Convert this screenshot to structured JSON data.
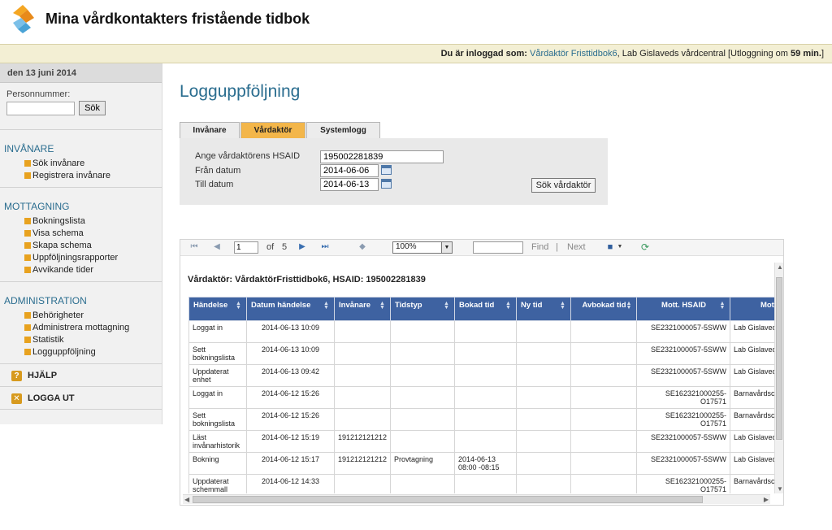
{
  "app": {
    "title": "Mina vårdkontakters fristående tidbok"
  },
  "login": {
    "prefix": "Du är inloggad som:",
    "user": "Vårdaktör Fristtidbok6",
    "unit": ", Lab Gislaveds vårdcentral [Utloggning om",
    "minutes": "59 min.",
    "suffix": "]"
  },
  "sidebar": {
    "date": "den 13 juni 2014",
    "pnr_label": "Personnummer:",
    "pnr_value": "",
    "search_label": "Sök",
    "sections": [
      {
        "title": "INVÅNARE",
        "items": [
          "Sök invånare",
          "Registrera invånare"
        ]
      },
      {
        "title": "MOTTAGNING",
        "items": [
          "Bokningslista",
          "Visa schema",
          "Skapa schema",
          "Uppföljningsrapporter",
          "Avvikande tider"
        ]
      },
      {
        "title": "ADMINISTRATION",
        "items": [
          "Behörigheter",
          "Administrera mottagning",
          "Statistik",
          "Logguppföljning"
        ]
      }
    ],
    "help_label": "HJÄLP",
    "logout_label": "LOGGA UT"
  },
  "main": {
    "title": "Logguppföljning",
    "tabs": [
      "Invånare",
      "Vårdaktör",
      "Systemlogg"
    ],
    "active_tab": "Vårdaktör",
    "filter": {
      "hsaid_label": "Ange vårdaktörens HSAID",
      "hsaid_value": "195002281839",
      "from_label": "Från datum",
      "from_value": "2014-06-06",
      "to_label": "Till datum",
      "to_value": "2014-06-13",
      "search_button": "Sök vårdaktör"
    }
  },
  "report": {
    "toolbar": {
      "page": "1",
      "of_label": "of",
      "total_pages": "5",
      "zoom": "100%",
      "find_value": "",
      "find_label": "Find",
      "separator": "|",
      "next_label": "Next"
    },
    "heading": "Vårdaktör: VårdaktörFristtidbok6, HSAID: 195002281839",
    "columns": [
      "Händelse",
      "Datum händelse",
      "Invånare",
      "Tidstyp",
      "Bokad tid",
      "Ny tid",
      "Avbokad tid",
      "Mott. HSAID",
      "Mott"
    ],
    "rows": [
      [
        "Loggat in",
        "2014-06-13 10:09",
        "",
        "",
        "",
        "",
        "",
        "SE2321000057-5SWW",
        "Lab Gislaved"
      ],
      [
        "Sett bokningslista",
        "2014-06-13 10:09",
        "",
        "",
        "",
        "",
        "",
        "SE2321000057-5SWW",
        "Lab Gislaved"
      ],
      [
        "Uppdaterat enhet",
        "2014-06-13 09:42",
        "",
        "",
        "",
        "",
        "",
        "SE2321000057-5SWW",
        "Lab Gislaved"
      ],
      [
        "Loggat in",
        "2014-06-12 15:26",
        "",
        "",
        "",
        "",
        "",
        "SE162321000255-O17571",
        "Barnavårdsc"
      ],
      [
        "Sett bokningslista",
        "2014-06-12 15:26",
        "",
        "",
        "",
        "",
        "",
        "SE162321000255-O17571",
        "Barnavårdsc hus"
      ],
      [
        "Läst invånarhistorik",
        "2014-06-12 15:19",
        "191212121212",
        "",
        "",
        "",
        "",
        "SE2321000057-5SWW",
        "Lab Gislaved"
      ],
      [
        "Bokning",
        "2014-06-12 15:17",
        "191212121212",
        "Provtagning",
        "2014-06-13 08:00 -08:15",
        "",
        "",
        "SE2321000057-5SWW",
        "Lab Gislaved"
      ],
      [
        "Uppdaterat schemmall",
        "2014-06-12 14:33",
        "",
        "",
        "",
        "",
        "",
        "SE162321000255-O17571",
        "Barnavårdsc hus"
      ]
    ]
  }
}
